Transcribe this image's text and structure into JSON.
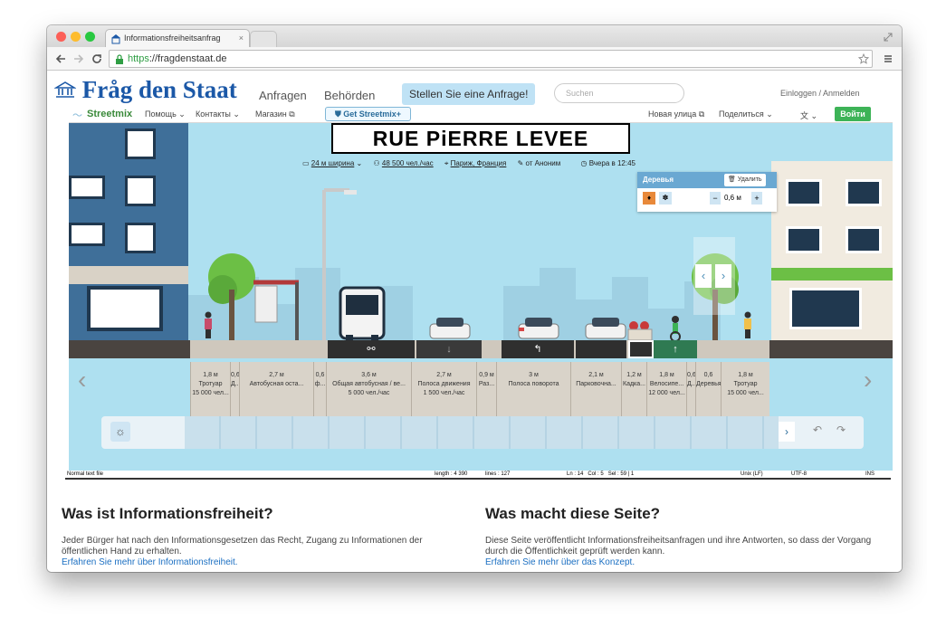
{
  "browser": {
    "tab_title": "Informationsfreiheitsanfrag",
    "url_scheme": "https",
    "url_rest": "://fragdenstaat.de"
  },
  "site": {
    "logo": "Fråg den Staat",
    "nav": [
      "Anfragen",
      "Behörden"
    ],
    "cta": "Stellen Sie eine Anfrage!",
    "search_placeholder": "Suchen",
    "login": "Einloggen / Anmelden"
  },
  "streetmix": {
    "menu": {
      "logo": "Streetmix",
      "help": "Помощь",
      "contacts": "Контакты",
      "store": "Магазин",
      "get_plus": "Get Streetmix+",
      "new_street": "Новая улица",
      "share": "Поделиться",
      "login": "Войти"
    },
    "street_name": "RUE PiERRE LEVEE",
    "meta": {
      "width": "24 м ширина",
      "capacity": "48 500 чел./час",
      "location": "Париж, Франция",
      "author": "от Аноним",
      "time": "Вчера в 12:45"
    },
    "popup": {
      "title": "Деревья",
      "delete": "Удалить",
      "width_value": "0,6 м"
    },
    "segments": [
      {
        "width": "1,8 м",
        "label": "Тротуар",
        "extra": "15 000 чел..."
      },
      {
        "width": "0,6",
        "label": "Д...",
        "extra": ""
      },
      {
        "width": "2,7 м",
        "label": "Автобусная оста...",
        "extra": ""
      },
      {
        "width": "0,6",
        "label": "ф...",
        "extra": ""
      },
      {
        "width": "3,6 м",
        "label": "Общая автобусная / ве...",
        "extra": "5 000 чел./час"
      },
      {
        "width": "2,7 м",
        "label": "Полоса движения",
        "extra": "1 500 чел./час"
      },
      {
        "width": "0,9 м",
        "label": "Раз...",
        "extra": ""
      },
      {
        "width": "3 м",
        "label": "Полоса поворота",
        "extra": ""
      },
      {
        "width": "2,1 м",
        "label": "Парковочна...",
        "extra": ""
      },
      {
        "width": "1,2 м",
        "label": "Кадка...",
        "extra": ""
      },
      {
        "width": "1,8 м",
        "label": "Велосипе...",
        "extra": "12 000 чел..."
      },
      {
        "width": "0,6",
        "label": "Д...",
        "extra": ""
      },
      {
        "width": "0,6",
        "label": "Деревья",
        "extra": ""
      },
      {
        "width": "1,8 м",
        "label": "Тротуар",
        "extra": "15 000 чел..."
      }
    ]
  },
  "editor_status": {
    "mode": "Normal text file",
    "length": "length : 4 390",
    "lines": "lines : 127",
    "position": "Ln : 14   Col : 5   Sel : 59 | 1",
    "eol": "Unix (LF)",
    "encoding": "UTF-8",
    "ins": "INS"
  },
  "info": {
    "left": {
      "heading": "Was ist Informationsfreiheit?",
      "text": "Jeder Bürger hat nach den Informationsgesetzen das Recht, Zugang zu Informationen der öffentlichen Hand zu erhalten.",
      "link": "Erfahren Sie mehr über Informationsfreiheit."
    },
    "right": {
      "heading": "Was macht diese Seite?",
      "text": "Diese Seite veröffentlicht Informationsfreiheitsanfragen und ihre Antworten, so dass der Vorgang durch die Öffentlichkeit geprüft werden kann.",
      "link": "Erfahren Sie mehr über das Konzept."
    }
  },
  "colors": {
    "brand_blue": "#1b58a7",
    "link_blue": "#1b6fc2",
    "streetmix_green": "#3db357",
    "sky": "#aee0f0"
  }
}
